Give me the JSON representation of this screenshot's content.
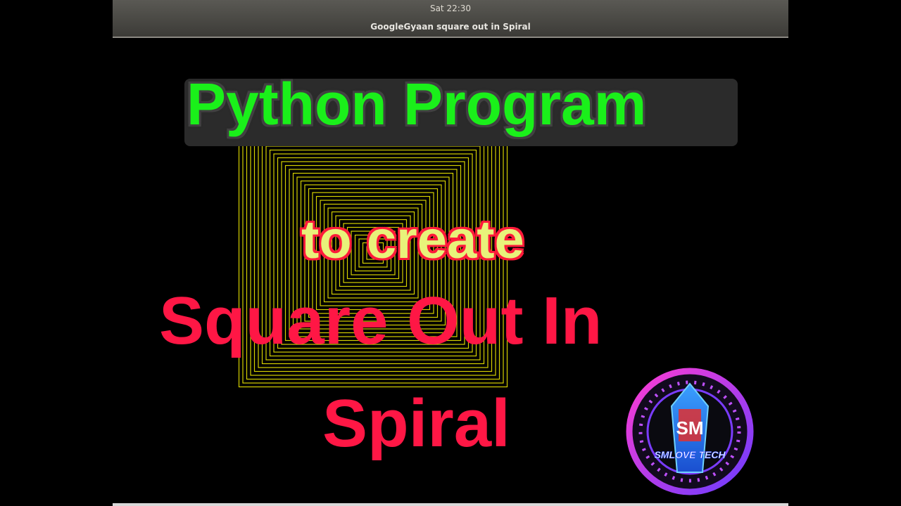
{
  "topbar": {
    "clock": "Sat 22:30",
    "window_title": "GoogleGyaan square out in Spiral"
  },
  "overlay": {
    "line1": "Python Program",
    "line2": "to create",
    "line3": "Square Out In",
    "line4": "Spiral"
  },
  "logo": {
    "text": "SMLOVE TECH",
    "monogram": "SM"
  },
  "colors": {
    "spiral_stroke": "#d4d000",
    "line1": "#1af01a",
    "line2": "#e8f27a",
    "line3": "#ff1745",
    "logo_ring": "#b03cff"
  }
}
